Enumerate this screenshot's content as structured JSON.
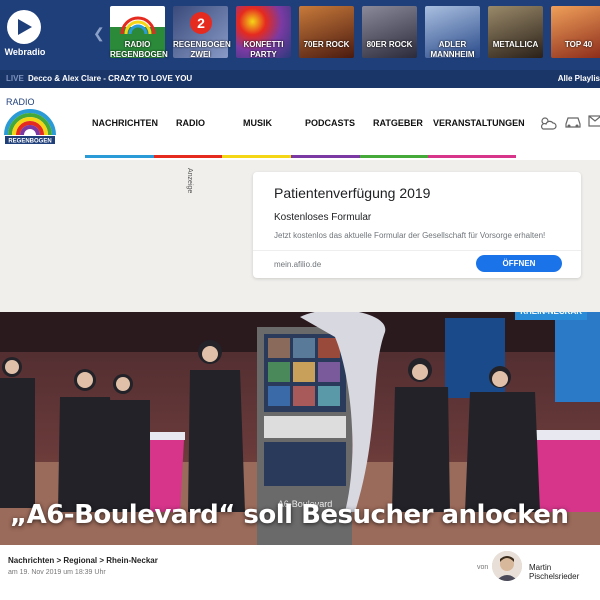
{
  "webradio": {
    "label": "Webradio"
  },
  "stations": [
    {
      "label": "RADIO REGENBOGEN",
      "bg": "#2a8a3a"
    },
    {
      "label": "REGENBOGEN ZWEI",
      "bg": "#4a5a8a"
    },
    {
      "label": "KONFETTI PARTY",
      "bg": "#6a5a9a"
    },
    {
      "label": "70ER ROCK",
      "bg": "#6a3020"
    },
    {
      "label": "80ER ROCK",
      "bg": "#4a4a5a"
    },
    {
      "label": "ADLER MANNHEIM",
      "bg": "#4a6a9a"
    },
    {
      "label": "METALLICA",
      "bg": "#5a4a3a"
    },
    {
      "label": "TOP 40",
      "bg": "#c85a2a"
    }
  ],
  "live": {
    "tag": "LIVE",
    "song": "Decco & Alex Clare - CRAZY TO LOVE YOU",
    "all_playlists": "Alle Playlis"
  },
  "logo": {
    "line1": "RADIO",
    "line2": "REGENBOGEN"
  },
  "nav": {
    "items": [
      {
        "label": "NACHRICHTEN",
        "color": "#2b9bd7"
      },
      {
        "label": "RADIO",
        "color": "#e52a1f"
      },
      {
        "label": "MUSIK",
        "color": "#f5d617"
      },
      {
        "label": "PODCASTS",
        "color": "#7b3aa3"
      },
      {
        "label": "RATGEBER",
        "color": "#45a93a"
      },
      {
        "label": "VERANSTALTUNGEN",
        "color": "#d6358a"
      }
    ],
    "icons": [
      "weather-icon",
      "car-icon",
      "mail-icon"
    ]
  },
  "ad": {
    "anzeige": "Anzeige",
    "title": "Patientenverfügung 2019",
    "subtitle": "Kostenloses Formular",
    "description": "Jetzt kostenlos das aktuelle Formular der Gesellschaft für Vorsorge erhalten!",
    "url": "mein.afilio.de",
    "button": "ÖFFNEN"
  },
  "article": {
    "region": "RHEIN-NECKAR",
    "headline": "„A6-Boulevard“ soll Besucher anlocken",
    "breadcrumb": "Nachrichten > Regional > Rhein-Neckar",
    "date": "am 19. Nov 2019 um 18:39 Uhr",
    "by": "von",
    "author": "Martin Pischelsrieder",
    "sign_text": "A6-Boulevard"
  }
}
